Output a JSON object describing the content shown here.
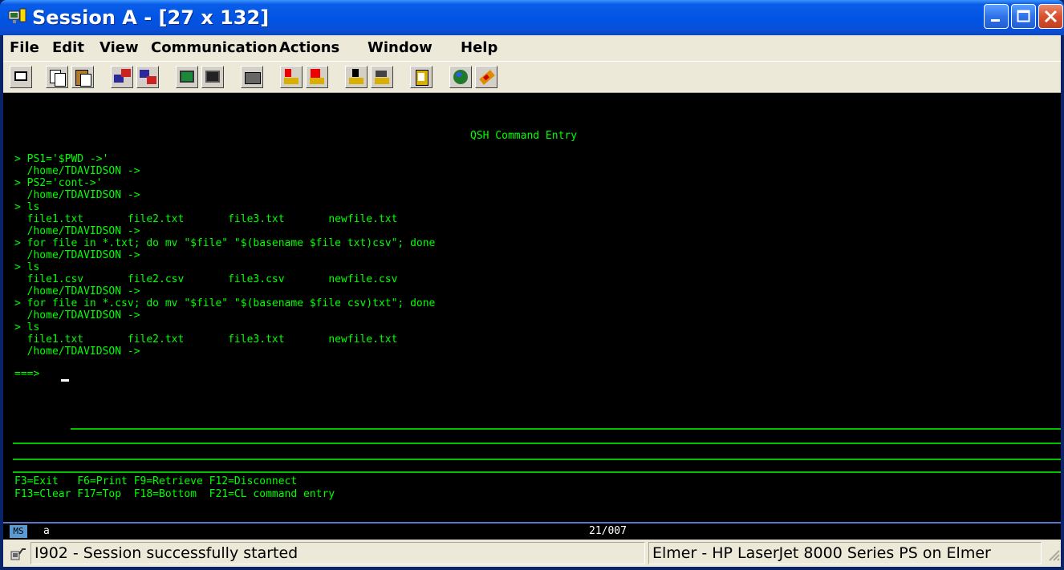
{
  "window": {
    "title": "Session A - [27 x 132]"
  },
  "menu": {
    "items": [
      "File",
      "Edit",
      "View",
      "Communication",
      "Actions",
      "Window",
      "Help"
    ]
  },
  "toolbar": {
    "icons": [
      "print-screen-icon",
      "copy-icon",
      "paste-icon",
      "send-file-icon",
      "receive-file-icon",
      "display-icon",
      "keypad-icon",
      "macro-icon",
      "record-macro-icon",
      "stop-macro-icon",
      "play-macro-icon",
      "macro-edit-icon",
      "clipboard-icon",
      "globe-icon",
      "support-icon"
    ]
  },
  "screen": {
    "heading": "QSH Command Entry",
    "lines": [
      "> PS1='$PWD ->'",
      "  /home/TDAVIDSON ->",
      "> PS2='cont->'",
      "  /home/TDAVIDSON ->",
      "> ls",
      "  file1.txt       file2.txt       file3.txt       newfile.txt",
      "  /home/TDAVIDSON ->",
      "> for file in *.txt; do mv \"$file\" \"$(basename $file txt)csv\"; done",
      "  /home/TDAVIDSON ->",
      "> ls",
      "  file1.csv       file2.csv       file3.csv       newfile.csv",
      "  /home/TDAVIDSON ->",
      "> for file in *.csv; do mv \"$file\" \"$(basename $file csv)txt\"; done",
      "  /home/TDAVIDSON ->",
      "> ls",
      "  file1.txt       file2.txt       file3.txt       newfile.txt",
      "  /home/TDAVIDSON ->"
    ],
    "prompt": "===>",
    "command_value": "",
    "fkeys_line1": "F3=Exit   F6=Print F9=Retrieve F12=Disconnect",
    "fkeys_line2": "F13=Clear F17=Top  F18=Bottom  F21=CL command entry",
    "colors": {
      "text": "#00ff00",
      "rule": "#00c000",
      "background": "#000000"
    }
  },
  "oia": {
    "indicator": "MS",
    "mode": "a",
    "cursor_position": "21/007"
  },
  "status": {
    "message": "I902 - Session successfully started",
    "printer": "Elmer - HP LaserJet 8000 Series PS on Elmer"
  }
}
